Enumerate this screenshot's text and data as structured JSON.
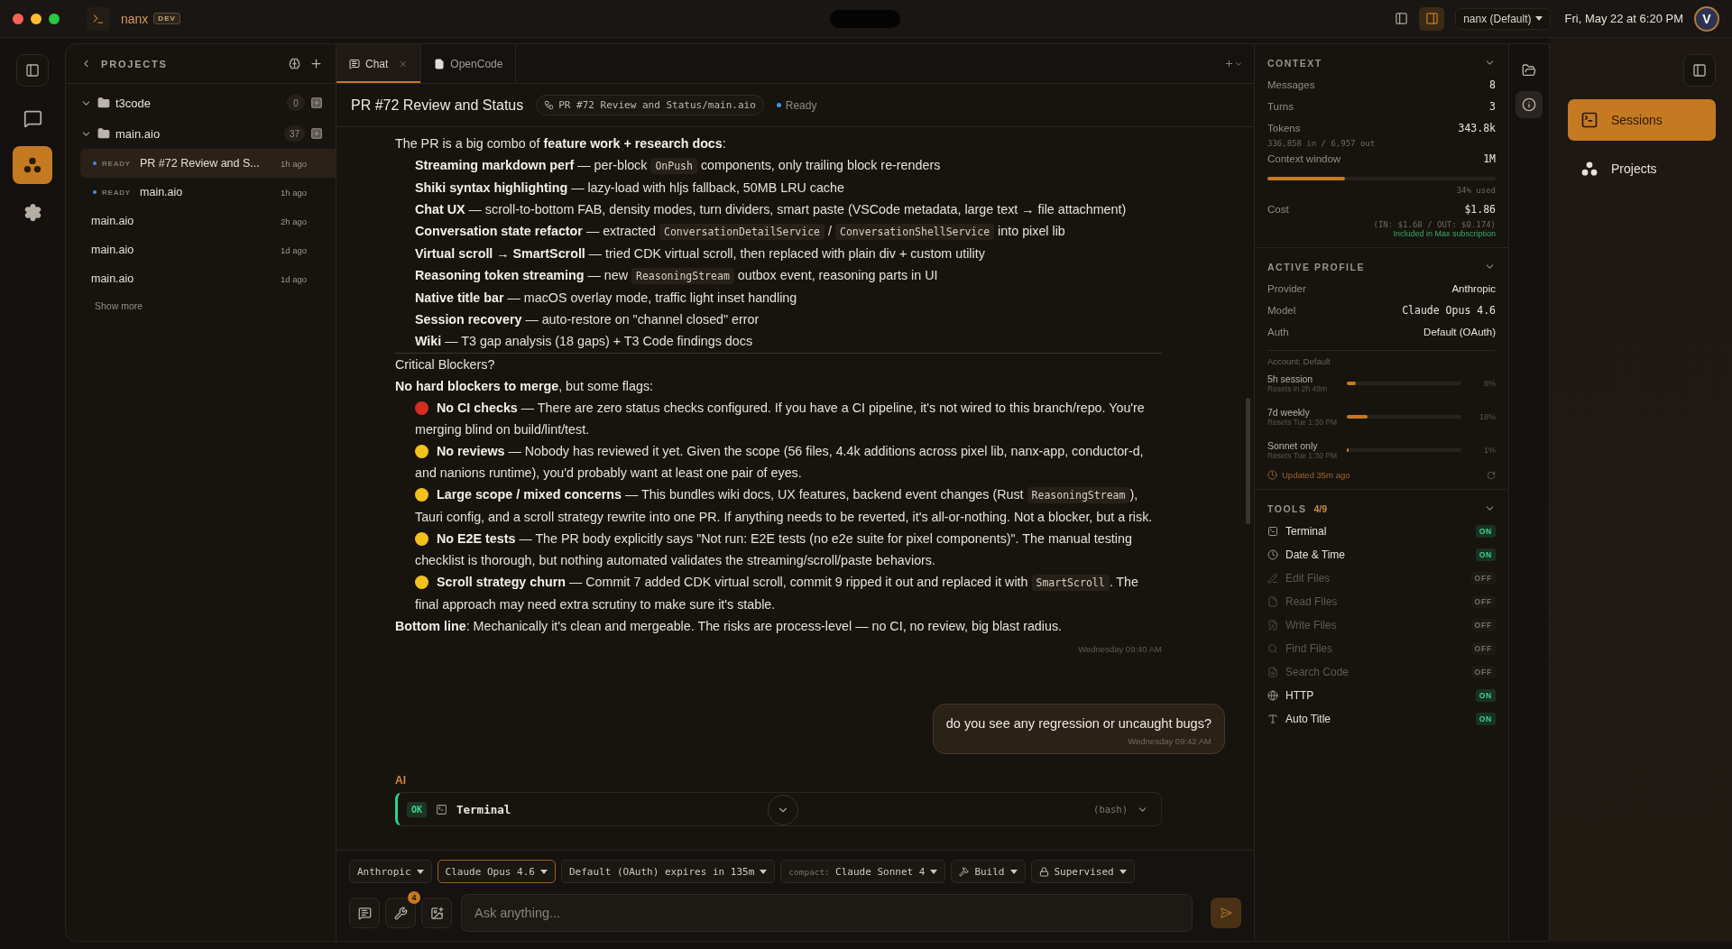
{
  "app": {
    "name": "nanx",
    "badge": "DEV"
  },
  "top_bar": {
    "toggles": [
      {
        "selected": false
      },
      {
        "selected": true
      }
    ],
    "profile": "nanx (Default)",
    "datetime": "Fri, May 22 at 6:20 PM",
    "avatar": "V"
  },
  "rail": {
    "items": [
      {
        "selected": false
      },
      {
        "selected": true
      },
      {
        "selected": false
      }
    ]
  },
  "projects_panel": {
    "title": "PROJECTS",
    "projects": [
      {
        "name": "t3code",
        "count": "0",
        "expanded": true
      },
      {
        "name": "main.aio",
        "count": "37",
        "expanded": true,
        "children": [
          {
            "status": "READY",
            "title": "PR #72 Review and S...",
            "time": "1h ago",
            "selected": true
          },
          {
            "status": "READY",
            "title": "main.aio",
            "time": "1h ago",
            "selected": false
          },
          {
            "title": "main.aio",
            "time": "2h ago",
            "selected": false
          },
          {
            "title": "main.aio",
            "time": "1d ago",
            "selected": false
          },
          {
            "title": "main.aio",
            "time": "1d ago",
            "selected": false
          }
        ]
      }
    ],
    "show_more": "Show more"
  },
  "chat": {
    "tabs": [
      {
        "label": "Chat",
        "selected": true
      },
      {
        "label": "OpenCode",
        "selected": false
      }
    ],
    "title": "PR #72 Review and Status",
    "path": "PR #72 Review and Status/main.aio",
    "status": "Ready",
    "messages": [
      {
        "kind": "answer",
        "lines": [
          {
            "kind": "para",
            "parts": [
              {
                "kind": "text",
                "text": "The PR is a big combo of "
              },
              {
                "kind": "bold",
                "text": "feature work + research docs"
              },
              {
                "kind": "text",
                "text": ":"
              }
            ]
          },
          {
            "kind": "item",
            "parts": [
              {
                "kind": "bold",
                "text": "Streaming markdown perf"
              },
              {
                "kind": "text",
                "text": " — per-block "
              },
              {
                "kind": "code",
                "text": "OnPush"
              },
              {
                "kind": "text",
                "text": " components, only trailing block re-renders"
              }
            ]
          },
          {
            "kind": "item",
            "parts": [
              {
                "kind": "bold",
                "text": "Shiki syntax highlighting"
              },
              {
                "kind": "text",
                "text": " — lazy-load with hljs fallback, 50MB LRU cache"
              }
            ]
          },
          {
            "kind": "item",
            "parts": [
              {
                "kind": "bold",
                "text": "Chat UX"
              },
              {
                "kind": "text",
                "text": " — scroll-to-bottom FAB, density modes, turn dividers, smart paste (VSCode metadata, large text → file attachment)"
              }
            ]
          },
          {
            "kind": "item",
            "parts": [
              {
                "kind": "bold",
                "text": "Conversation state refactor"
              },
              {
                "kind": "text",
                "text": " — extracted "
              },
              {
                "kind": "code",
                "text": "ConversationDetailService"
              },
              {
                "kind": "text",
                "text": " / "
              },
              {
                "kind": "code",
                "text": "ConversationShellService"
              },
              {
                "kind": "text",
                "text": " into pixel lib"
              }
            ]
          },
          {
            "kind": "item",
            "parts": [
              {
                "kind": "bold",
                "text": "Virtual scroll → SmartScroll"
              },
              {
                "kind": "text",
                "text": " — tried CDK virtual scroll, then replaced with plain div + custom utility"
              }
            ]
          },
          {
            "kind": "item",
            "parts": [
              {
                "kind": "bold",
                "text": "Reasoning token streaming"
              },
              {
                "kind": "text",
                "text": " — new "
              },
              {
                "kind": "code",
                "text": "ReasoningStream"
              },
              {
                "kind": "text",
                "text": " outbox event, reasoning parts in UI"
              }
            ]
          },
          {
            "kind": "item",
            "parts": [
              {
                "kind": "bold",
                "text": "Native title bar"
              },
              {
                "kind": "text",
                "text": " — macOS overlay mode, traffic light inset handling"
              }
            ]
          },
          {
            "kind": "item",
            "parts": [
              {
                "kind": "bold",
                "text": "Session recovery"
              },
              {
                "kind": "text",
                "text": " — auto-restore on \"channel closed\" error"
              }
            ]
          },
          {
            "kind": "item",
            "parts": [
              {
                "kind": "bold",
                "text": "Wiki"
              },
              {
                "kind": "text",
                "text": " — T3 gap analysis (18 gaps) + T3 Code findings docs"
              }
            ]
          },
          {
            "kind": "section",
            "parts": [
              {
                "kind": "text",
                "text": "Critical Blockers?"
              }
            ]
          },
          {
            "kind": "para",
            "parts": [
              {
                "kind": "bold",
                "text": "No hard blockers to merge"
              },
              {
                "kind": "text",
                "text": ", but some flags:"
              }
            ]
          },
          {
            "kind": "item",
            "color": "#d92d20",
            "parts": [
              {
                "kind": "bold",
                "text": "No CI checks"
              },
              {
                "kind": "text",
                "text": " — There are zero status checks configured. If you have a CI pipeline, it's not wired to this branch/repo. You're merging blind on build/lint/test."
              }
            ]
          },
          {
            "kind": "item",
            "color": "#f2c21b",
            "parts": [
              {
                "kind": "bold",
                "text": "No reviews"
              },
              {
                "kind": "text",
                "text": " — Nobody has reviewed it yet. Given the scope (56 files, 4.4k additions across pixel lib, nanx-app, conductor-d, and nanions runtime), you'd probably want at least one pair of eyes."
              }
            ]
          },
          {
            "kind": "item",
            "color": "#f2c21b",
            "parts": [
              {
                "kind": "bold",
                "text": "Large scope / mixed concerns"
              },
              {
                "kind": "text",
                "text": " — This bundles wiki docs, UX features, backend event changes (Rust "
              },
              {
                "kind": "code",
                "text": "ReasoningStream"
              },
              {
                "kind": "text",
                "text": "), Tauri config, and a scroll strategy rewrite into one PR. If anything needs to be reverted, it's all-or-nothing. Not a blocker, but a risk."
              }
            ]
          },
          {
            "kind": "item",
            "color": "#f2c21b",
            "parts": [
              {
                "kind": "bold",
                "text": "No E2E tests"
              },
              {
                "kind": "text",
                "text": " — The PR body explicitly says \"Not run: E2E tests (no e2e suite for pixel components)\". The manual testing checklist is thorough, but nothing automated validates the streaming/scroll/paste behaviors."
              }
            ]
          },
          {
            "kind": "item",
            "color": "#f2c21b",
            "parts": [
              {
                "kind": "bold",
                "text": "Scroll strategy churn"
              },
              {
                "kind": "text",
                "text": " — Commit 7 added CDK virtual scroll, commit 9 ripped it out and replaced it with "
              },
              {
                "kind": "code",
                "text": "SmartScroll"
              },
              {
                "kind": "text",
                "text": ". The final approach may need extra scrutiny to make sure it's stable."
              }
            ]
          },
          {
            "kind": "para",
            "parts": [
              {
                "kind": "bold",
                "text": "Bottom line"
              },
              {
                "kind": "text",
                "text": ": Mechanically it's clean and mergeable. The risks are process-level — no CI, no review, big blast radius."
              }
            ]
          }
        ],
        "time": "Wednesday 09:40 AM"
      },
      {
        "kind": "question",
        "text": "do you see any regression or uncaught bugs?",
        "time": "Wednesday 09:42 AM"
      },
      {
        "kind": "tool_call",
        "author": "AI",
        "tool": {
          "status": "OK",
          "name": "Terminal",
          "detail": "(bash)"
        }
      }
    ],
    "composer": {
      "chips": [
        {
          "kind": "plain",
          "label": "Anthropic",
          "highlighted": false
        },
        {
          "kind": "plain",
          "label": "Claude Opus 4.6",
          "highlighted": true
        },
        {
          "kind": "plain",
          "label": "Default (OAuth) expires in 135m",
          "highlighted": false
        },
        {
          "kind": "compact",
          "prefix": "compact:",
          "label": "Claude Sonnet 4",
          "highlighted": false
        },
        {
          "kind": "build",
          "label": "Build",
          "highlighted": false
        },
        {
          "kind": "lock",
          "label": "Supervised",
          "highlighted": false
        }
      ],
      "tools_badge": "4",
      "placeholder": "Ask anything..."
    }
  },
  "context": {
    "title": "CONTEXT",
    "stats": [
      {
        "label": "Messages",
        "value": "8"
      },
      {
        "label": "Turns",
        "value": "3"
      },
      {
        "label": "Tokens",
        "value": "343.8k",
        "detail": "336,858 in / 6,957 out"
      },
      {
        "label": "Context window",
        "value": "1M"
      }
    ],
    "window": {
      "level": 0.34,
      "reading": "34% used"
    },
    "cost": {
      "label": "Cost",
      "value": "$1.86",
      "breakdown": "(IN: $1.68 / OUT: $0.174)",
      "note": "Included in Max subscription"
    }
  },
  "active_profile": {
    "title": "ACTIVE PROFILE",
    "fields": [
      {
        "label": "Provider",
        "value": "Anthropic",
        "kind": "text"
      },
      {
        "label": "Model",
        "value": "Claude Opus 4.6",
        "kind": "mono"
      },
      {
        "label": "Auth",
        "value": "Default (OAuth)",
        "kind": "text"
      }
    ],
    "account": "Account: Default",
    "limits": [
      {
        "name": "5h session",
        "resets": "Resets in 2h 49m",
        "level": 0.08,
        "reading": "8%"
      },
      {
        "name": "7d weekly",
        "resets": "Resets Tue 1:30 PM",
        "level": 0.18,
        "reading": "18%"
      },
      {
        "name": "Sonnet only",
        "resets": "Resets Tue 1:30 PM",
        "level": 0.01,
        "reading": "1%"
      }
    ],
    "updated": "Updated 35m ago"
  },
  "tools": {
    "title": "TOOLS",
    "count": "4/9",
    "items": [
      {
        "name": "Terminal",
        "on": true,
        "badge": "ON"
      },
      {
        "name": "Date & Time",
        "on": true,
        "badge": "ON"
      },
      {
        "name": "Edit Files",
        "on": false,
        "badge": "OFF"
      },
      {
        "name": "Read Files",
        "on": false,
        "badge": "OFF"
      },
      {
        "name": "Write Files",
        "on": false,
        "badge": "OFF"
      },
      {
        "name": "Find Files",
        "on": false,
        "badge": "OFF"
      },
      {
        "name": "Search Code",
        "on": false,
        "badge": "OFF"
      },
      {
        "name": "HTTP",
        "on": true,
        "badge": "ON"
      },
      {
        "name": "Auto Title",
        "on": true,
        "badge": "ON"
      }
    ]
  },
  "nav": [
    {
      "label": "Sessions",
      "selected": true
    },
    {
      "label": "Projects",
      "selected": false
    }
  ]
}
